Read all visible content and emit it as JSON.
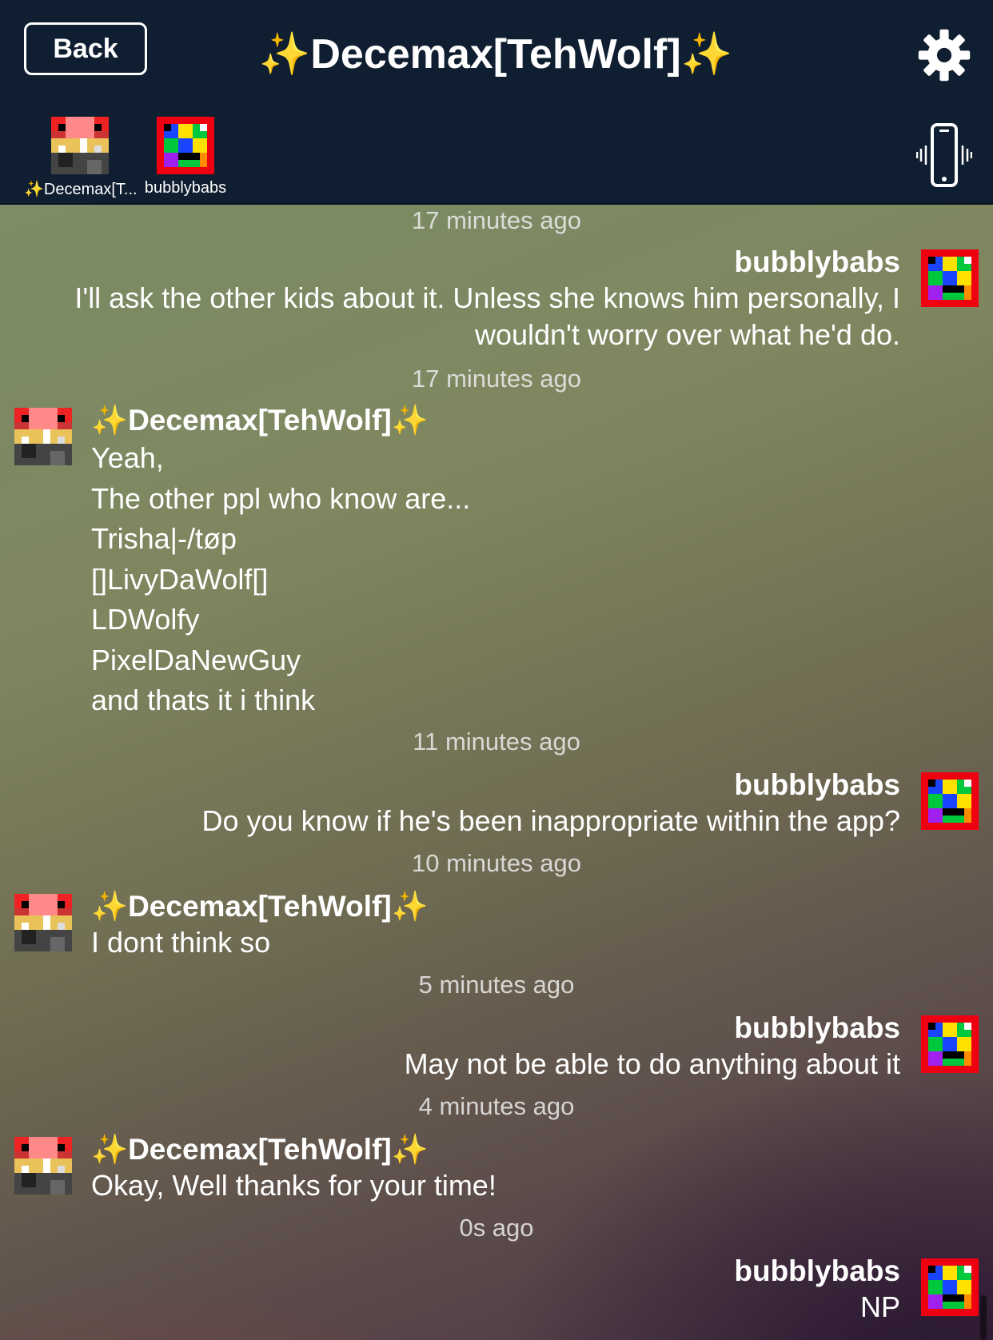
{
  "header": {
    "back_label": "Back",
    "title": "✨Decemax[TehWolf]✨",
    "participants": [
      {
        "name": "✨Decemax[T...",
        "avatar_icon": "pixel-avatar-red"
      },
      {
        "name": "bubblybabs",
        "avatar_icon": "pixel-avatar-rainbow"
      }
    ],
    "settings_icon": "gear-icon",
    "vibrate_icon": "phone-vibrate-icon"
  },
  "messages": [
    {
      "timestamp": "17 minutes ago"
    },
    {
      "side": "right",
      "sender": "bubblybabs",
      "text": "I'll ask the other kids about it.  Unless she knows him personally, I\nwouldn't worry over what he'd do."
    },
    {
      "timestamp": "17 minutes ago"
    },
    {
      "side": "left",
      "sender": "✨Decemax[TehWolf]✨",
      "text": "Yeah,\nThe other ppl who know are...\nTrisha|-/tøp\n[]LivyDaWolf[]\nLDWolfy\nPixelDaNewGuy\nand thats it i think"
    },
    {
      "timestamp": "11 minutes ago"
    },
    {
      "side": "right",
      "sender": "bubblybabs",
      "text": "Do you know if he's been inappropriate within the app?"
    },
    {
      "timestamp": "10 minutes ago"
    },
    {
      "side": "left",
      "sender": "✨Decemax[TehWolf]✨",
      "text": "I dont think so"
    },
    {
      "timestamp": "5 minutes ago"
    },
    {
      "side": "right",
      "sender": "bubblybabs",
      "text": "May not be able to do anything about it"
    },
    {
      "timestamp": "4 minutes ago"
    },
    {
      "side": "left",
      "sender": "✨Decemax[TehWolf]✨",
      "text": "Okay, Well thanks for your time!"
    },
    {
      "timestamp": "0s ago"
    },
    {
      "side": "right",
      "sender": "bubblybabs",
      "text": "NP"
    }
  ],
  "colors": {
    "header_bg": "#0f1e30",
    "text": "#ffffff"
  }
}
